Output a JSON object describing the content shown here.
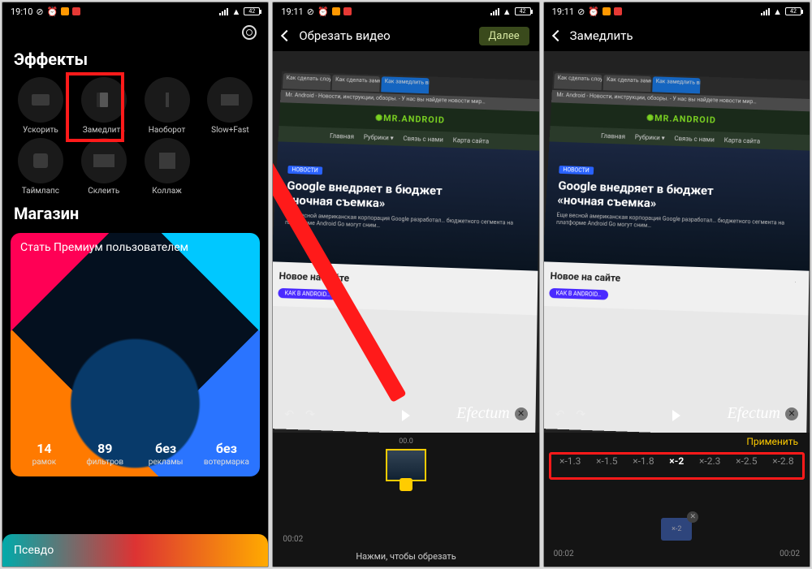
{
  "colors": {
    "highlight": "#ff1a1a",
    "accent_yellow": "#ffcc00",
    "next_btn_bg": "#3a4a1c"
  },
  "screen1": {
    "status": {
      "time": "19:10",
      "battery": "42"
    },
    "title_effects": "Эффекты",
    "fx": [
      {
        "label": "Ускорить"
      },
      {
        "label": "Замедлить"
      },
      {
        "label": "Наоборот"
      },
      {
        "label": "Slow+Fast"
      },
      {
        "label": "Таймлапс"
      },
      {
        "label": "Склеить"
      },
      {
        "label": "Коллаж"
      }
    ],
    "highlighted_fx_index": 1,
    "title_store": "Магазин",
    "premium_title": "Стать Премиум пользователем",
    "premium_stats": [
      {
        "n": "14",
        "l": "рамок"
      },
      {
        "n": "89",
        "l": "фильтров"
      },
      {
        "n": "без",
        "l": "рекламы"
      },
      {
        "n": "без",
        "l": "вотермарка"
      }
    ],
    "pseudo_label": "Псевдо"
  },
  "screen2": {
    "status": {
      "time": "19:11",
      "battery": "42"
    },
    "nav_title": "Обрезать видео",
    "next_label": "Далее",
    "watermark": "Efectum",
    "timestamps": {
      "top": "00.0",
      "left": "00:02"
    },
    "hint": "Нажми, чтобы обрезать",
    "web": {
      "tabs": [
        "Как сделать слоумо на анд…",
        "Как сделать замедленное в…",
        "Как замедлить видео на A…"
      ],
      "addr": "Mr. Android - Новости, инструкции, обзоры. - У нас вы найдете новости мир…",
      "logo": "MR.ANDROID",
      "menu": [
        "Главная",
        "Рубрики ▾",
        "Связь с нами",
        "Карта сайта"
      ],
      "hero_badge": "НОВОСТИ",
      "hero_title_a": "Google внедряет в бюджет",
      "hero_title_b": "«ночная съемка»",
      "hero_sub": "Еще весной американская корпорация Google разработал… бюджетного сегмента на платформе Android Go могут сним…",
      "sec2_title": "Новое на сайте",
      "sec2_badge": "КАК В ANDROID…"
    }
  },
  "screen3": {
    "status": {
      "time": "19:11",
      "battery": "42"
    },
    "nav_title": "Замедлить",
    "watermark": "Efectum",
    "apply_label": "Применить",
    "speeds": [
      "×-1.3",
      "×-1.5",
      "×-1.8",
      "×-2",
      "×-2.3",
      "×-2.5",
      "×-2.8"
    ],
    "selected_speed_index": 3,
    "thumb_label": "×-2",
    "timestamps": {
      "left": "00:02",
      "right": "00:02"
    }
  }
}
